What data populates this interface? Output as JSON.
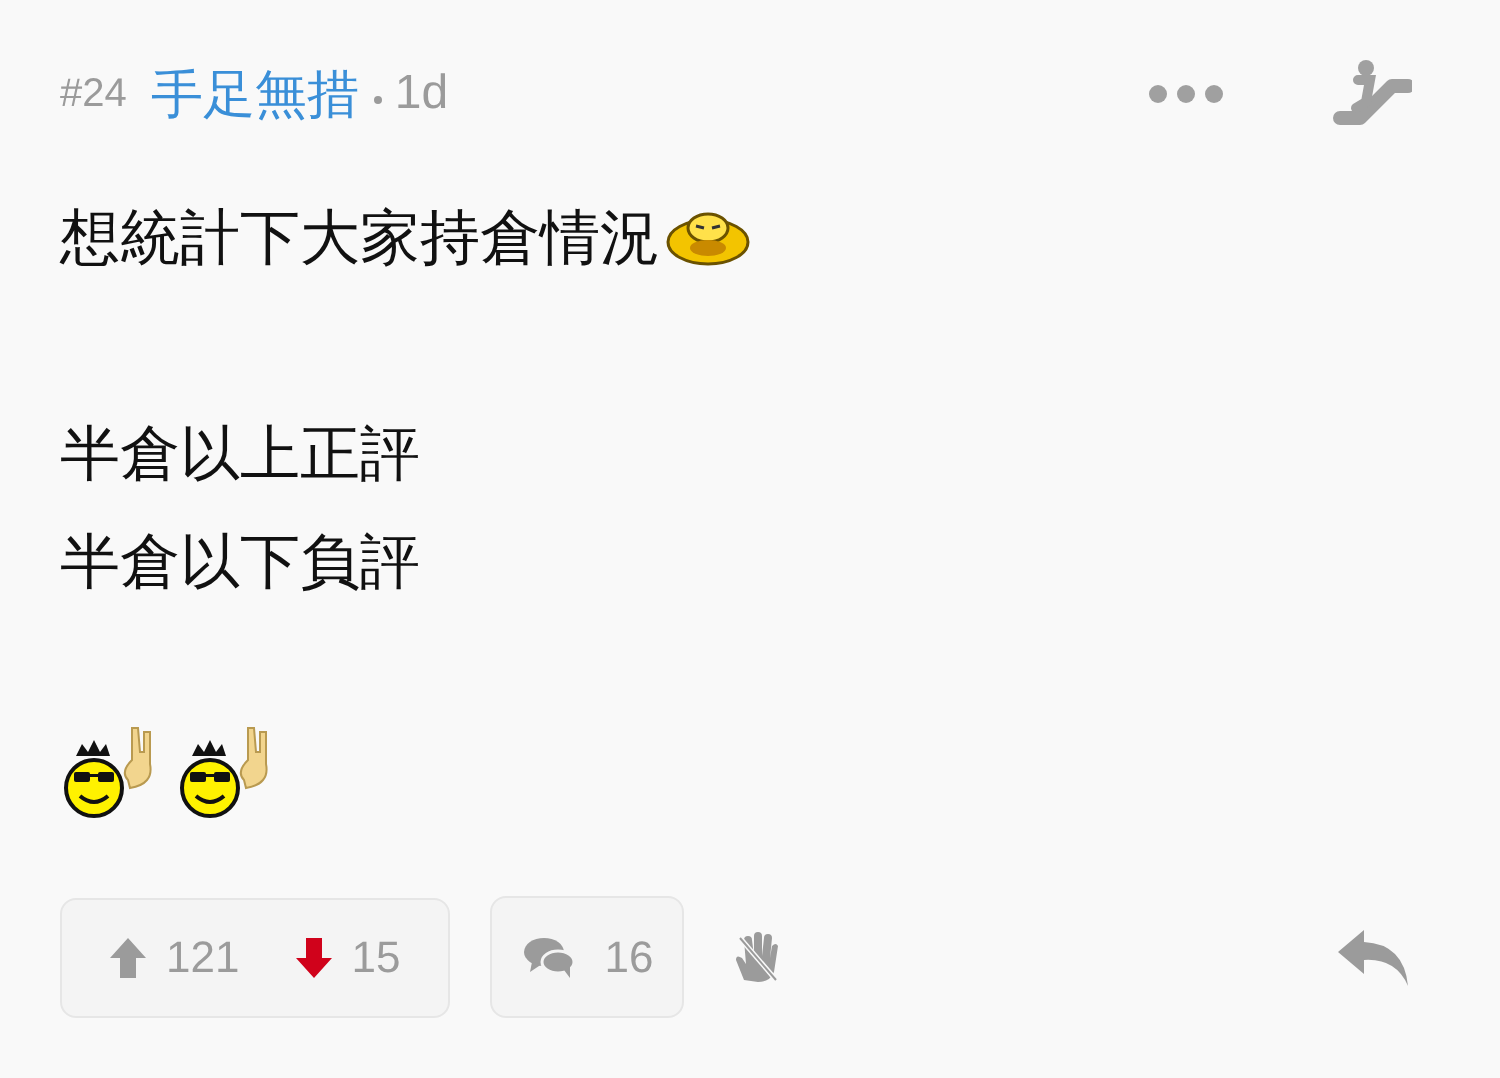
{
  "post": {
    "number": "#24",
    "author": "手足無措",
    "time": "1d"
  },
  "paragraphs": [
    [
      "想統計下大家持倉情況"
    ],
    [
      "半倉以上正評",
      "半倉以下負評"
    ]
  ],
  "votes": [
    {
      "kind": "up",
      "count": "121",
      "selected": false
    },
    {
      "kind": "down",
      "count": "15",
      "selected": true
    }
  ],
  "comments": {
    "count": "16"
  }
}
